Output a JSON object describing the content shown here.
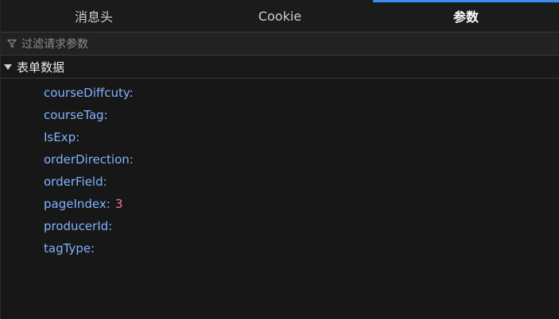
{
  "tabs": {
    "headers": "消息头",
    "cookie": "Cookie",
    "params": "参数"
  },
  "filter": {
    "placeholder": "过滤请求参数"
  },
  "section": {
    "title": "表单数据"
  },
  "form_data": [
    {
      "key": "courseDiffcuty:",
      "value": ""
    },
    {
      "key": "courseTag:",
      "value": ""
    },
    {
      "key": "IsExp:",
      "value": ""
    },
    {
      "key": "orderDirection:",
      "value": ""
    },
    {
      "key": "orderField:",
      "value": ""
    },
    {
      "key": "pageIndex:",
      "value": "3"
    },
    {
      "key": "producerId:",
      "value": ""
    },
    {
      "key": "tagType:",
      "value": ""
    }
  ]
}
